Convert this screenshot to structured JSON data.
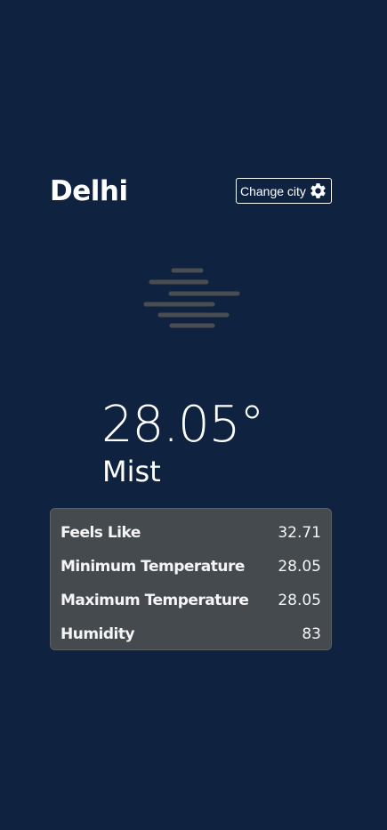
{
  "city": "Delhi",
  "change_city_label": "Change city",
  "weather_icon": "mist-icon",
  "temperature": "28.05°",
  "condition": "Mist",
  "details": [
    {
      "label": "Feels Like",
      "value": "32.71"
    },
    {
      "label": "Minimum Temperature",
      "value": "28.05"
    },
    {
      "label": "Maximum Temperature",
      "value": "28.05"
    },
    {
      "label": "Humidity",
      "value": "83"
    }
  ],
  "colors": {
    "background": "#0f2341",
    "card": "#454a4f",
    "mist_lines": "#4a4d52",
    "text": "#ffffff"
  }
}
